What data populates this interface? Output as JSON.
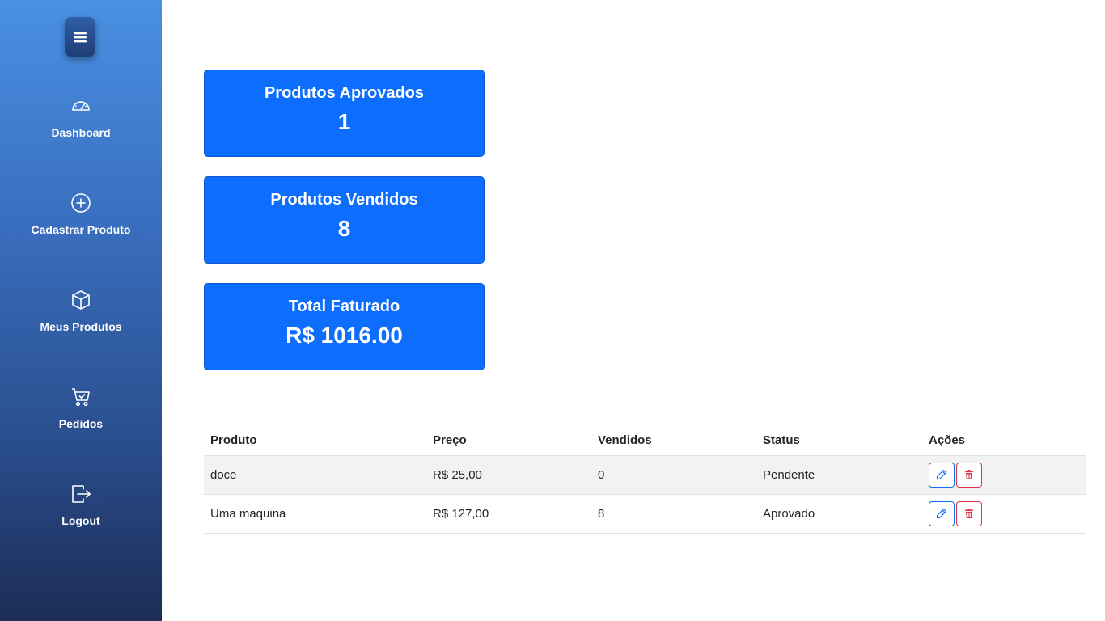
{
  "colors": {
    "accent": "#0d6efd",
    "danger": "#dc3545",
    "sidebar_top": "#4a90e2",
    "sidebar_bottom": "#1c2d56"
  },
  "sidebar": {
    "toggle_icon": "hamburger-menu-icon",
    "items": [
      {
        "label": "Dashboard",
        "icon": "speedometer-icon"
      },
      {
        "label": "Cadastrar Produto",
        "icon": "plus-circle-icon"
      },
      {
        "label": "Meus Produtos",
        "icon": "box-icon"
      },
      {
        "label": "Pedidos",
        "icon": "cart-check-icon"
      },
      {
        "label": "Logout",
        "icon": "logout-icon"
      }
    ]
  },
  "cards": [
    {
      "title": "Produtos Aprovados",
      "value": "1"
    },
    {
      "title": "Produtos Vendidos",
      "value": "8"
    },
    {
      "title": "Total Faturado",
      "value": "R$ 1016.00"
    }
  ],
  "table": {
    "headers": [
      "Produto",
      "Preço",
      "Vendidos",
      "Status",
      "Ações"
    ],
    "rows": [
      {
        "produto": "doce",
        "preco": "R$ 25,00",
        "vendidos": "0",
        "status": "Pendente"
      },
      {
        "produto": "Uma maquina",
        "preco": "R$ 127,00",
        "vendidos": "8",
        "status": "Aprovado"
      }
    ],
    "action_icons": [
      "pencil-icon",
      "trash-icon"
    ]
  }
}
